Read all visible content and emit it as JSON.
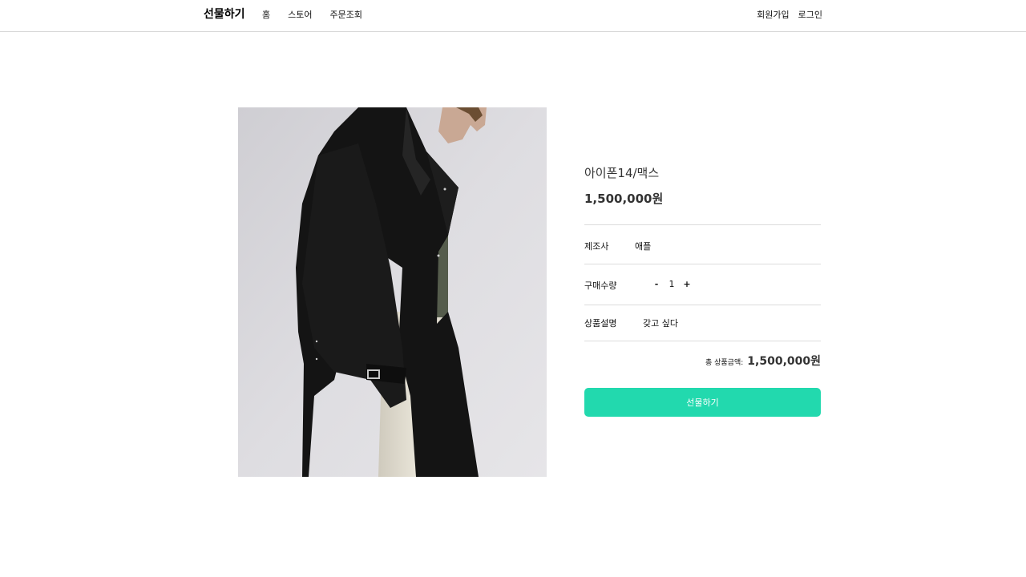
{
  "header": {
    "logo": "선물하기",
    "nav": [
      "홈",
      "스토어",
      "주문조회"
    ],
    "auth": [
      "회원가입",
      "로그인"
    ]
  },
  "product": {
    "name": "아이폰14/맥스",
    "price": "1,500,000원",
    "manufacturer_label": "제조사",
    "manufacturer": "애플",
    "quantity_label": "구매수량",
    "quantity_minus": "-",
    "quantity": "1",
    "quantity_plus": "+",
    "description_label": "상품설명",
    "description": "갖고 싶다",
    "total_label": "총 상품금액:",
    "total_price": "1,500,000원",
    "gift_button": "선물하기"
  },
  "colors": {
    "accent": "#22d9ae",
    "divider": "#dcdcdc"
  },
  "image": {
    "subject": "model-in-black-trench-coat"
  }
}
